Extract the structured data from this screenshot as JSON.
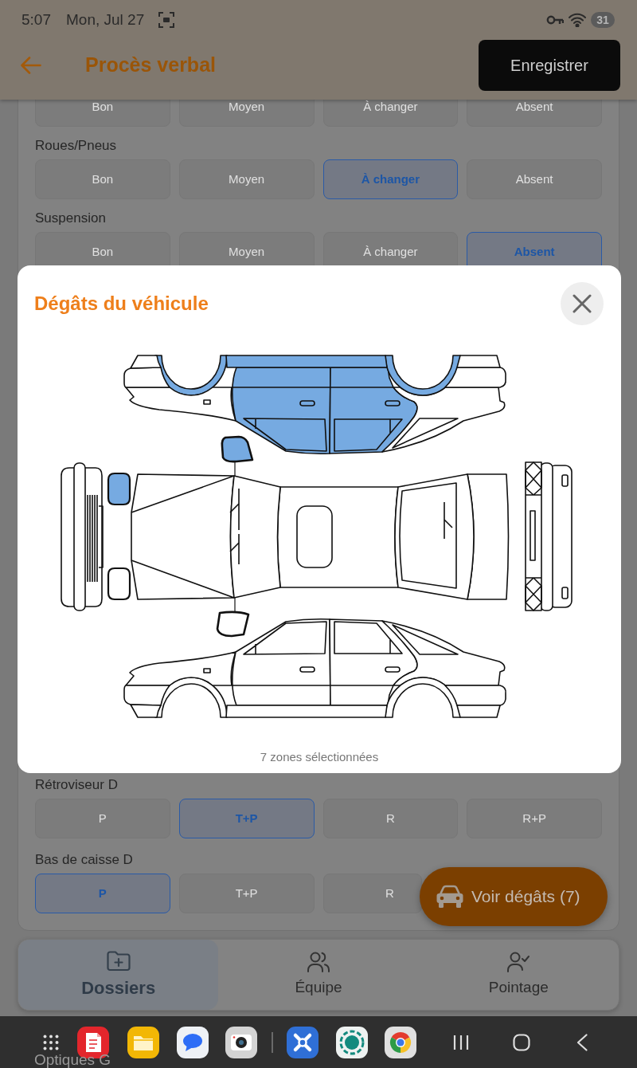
{
  "status_bar": {
    "time": "5:07",
    "date": "Mon, Jul 27",
    "battery": "31"
  },
  "app_bar": {
    "title": "Procès verbal",
    "save_button": "Enregistrer"
  },
  "form": {
    "rows_top": [
      {
        "options": [
          {
            "label": "Bon",
            "selected": false
          },
          {
            "label": "Moyen",
            "selected": false
          },
          {
            "label": "À changer",
            "selected": false
          },
          {
            "label": "Absent",
            "selected": false
          }
        ]
      },
      {
        "label": "Roues/Pneus",
        "options": [
          {
            "label": "Bon",
            "selected": false
          },
          {
            "label": "Moyen",
            "selected": false
          },
          {
            "label": "À changer",
            "selected": true
          },
          {
            "label": "Absent",
            "selected": false
          }
        ]
      },
      {
        "label": "Suspension",
        "options": [
          {
            "label": "Bon",
            "selected": false
          },
          {
            "label": "Moyen",
            "selected": false
          },
          {
            "label": "À changer",
            "selected": false
          },
          {
            "label": "Absent",
            "selected": true
          }
        ]
      }
    ],
    "rows_bottom": [
      {
        "label": "Rétroviseur D",
        "options": [
          {
            "label": "P",
            "selected": false
          },
          {
            "label": "T+P",
            "selected": true
          },
          {
            "label": "R",
            "selected": false
          },
          {
            "label": "R+P",
            "selected": false
          }
        ]
      },
      {
        "label": "Bas de caisse D",
        "options": [
          {
            "label": "P",
            "selected": true
          },
          {
            "label": "T+P",
            "selected": false
          },
          {
            "label": "R",
            "selected": false
          }
        ]
      }
    ]
  },
  "damage_button": {
    "label": "Voir dégâts (7)"
  },
  "bottom_nav": [
    {
      "label": "Dossiers",
      "selected": true
    },
    {
      "label": "Équipe",
      "selected": false
    },
    {
      "label": "Pointage",
      "selected": false
    }
  ],
  "next_section": {
    "label": "Optiques G"
  },
  "dialog": {
    "title": "Dégâts du véhicule",
    "zones": [
      {
        "selected": true
      },
      {
        "selected": true
      },
      {
        "selected": false
      },
      {
        "selected": true
      },
      {
        "selected": true
      },
      {
        "selected": false
      },
      {
        "selected": true
      },
      {
        "selected": true
      },
      {
        "selected": true
      },
      {
        "selected": false
      },
      {
        "selected": false
      },
      {
        "selected": false
      },
      {
        "selected": false
      },
      {
        "selected": false
      },
      {
        "selected": false
      },
      {
        "selected": false
      },
      {
        "selected": false
      },
      {
        "selected": false
      },
      {
        "selected": false
      },
      {
        "selected": false
      },
      {
        "selected": false
      }
    ],
    "caption": "7 zones sélectionnées"
  }
}
